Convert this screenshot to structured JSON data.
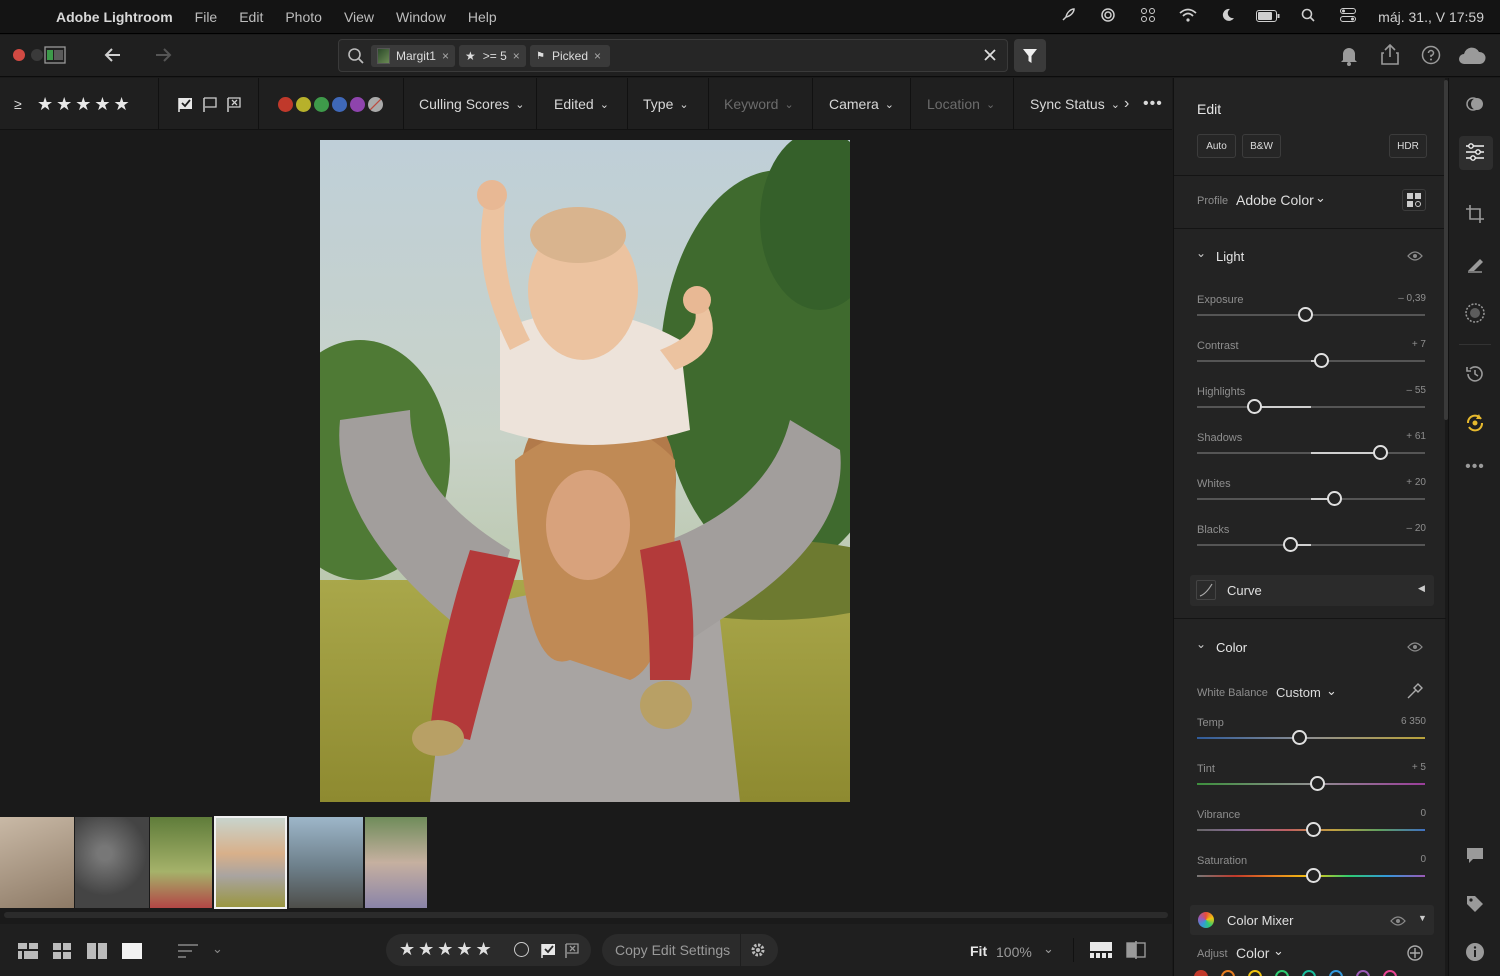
{
  "menubar": {
    "app_name": "Adobe Lightroom",
    "items": [
      "File",
      "Edit",
      "Photo",
      "View",
      "Window",
      "Help"
    ],
    "clock": "máj. 31., V  17:59"
  },
  "search": {
    "chips": [
      {
        "label": "Margit1"
      },
      {
        "label": ">= 5"
      },
      {
        "label": "Picked"
      }
    ]
  },
  "filterbar": {
    "rating_op": "≥",
    "stars": "★ ★ ★ ★ ★",
    "colors": [
      "#c0392b",
      "#b7b12b",
      "#3e9a4a",
      "#3f68b8",
      "#8e44ad"
    ],
    "dropdowns": [
      {
        "label": "Culling Scores",
        "enabled": true
      },
      {
        "label": "Edited",
        "enabled": true
      },
      {
        "label": "Type",
        "enabled": true
      },
      {
        "label": "Keyword",
        "enabled": false
      },
      {
        "label": "Camera",
        "enabled": true
      },
      {
        "label": "Location",
        "enabled": false
      },
      {
        "label": "Sync Status",
        "enabled": true
      }
    ]
  },
  "bottombar": {
    "stars": "★ ★ ★ ★ ★",
    "copy_label": "Copy Edit Settings",
    "fit_label": "Fit",
    "zoom": "100%"
  },
  "panel": {
    "title": "Edit",
    "buttons": {
      "auto": "Auto",
      "bw": "B&W",
      "hdr": "HDR"
    },
    "profile_label": "Profile",
    "profile_value": "Adobe Color",
    "light": {
      "title": "Light",
      "sliders": [
        {
          "label": "Exposure",
          "value": "– 0,39",
          "pos": 0.475
        },
        {
          "label": "Contrast",
          "value": "+ 7",
          "pos": 0.545
        },
        {
          "label": "Highlights",
          "value": "– 55",
          "pos": 0.25
        },
        {
          "label": "Shadows",
          "value": "+ 61",
          "pos": 0.805
        },
        {
          "label": "Whites",
          "value": "+ 20",
          "pos": 0.605
        },
        {
          "label": "Blacks",
          "value": "– 20",
          "pos": 0.41
        }
      ]
    },
    "curve_label": "Curve",
    "color": {
      "title": "Color",
      "wb_label": "White Balance",
      "wb_value": "Custom",
      "sliders": [
        {
          "label": "Temp",
          "value": "6 350",
          "pos": 0.45
        },
        {
          "label": "Tint",
          "value": "+ 5",
          "pos": 0.53
        },
        {
          "label": "Vibrance",
          "value": "0",
          "pos": 0.51
        },
        {
          "label": "Saturation",
          "value": "0",
          "pos": 0.51
        }
      ]
    },
    "mixer_label": "Color Mixer",
    "adjust_label": "Adjust",
    "adjust_value": "Color"
  },
  "icons": {
    "rail": [
      "presets-icon",
      "edit-sliders-icon",
      "crop-icon",
      "healing-icon",
      "masking-icon",
      "history-icon",
      "auto-icon",
      "more-icon",
      "comment-icon",
      "tag-icon",
      "info-icon"
    ]
  }
}
